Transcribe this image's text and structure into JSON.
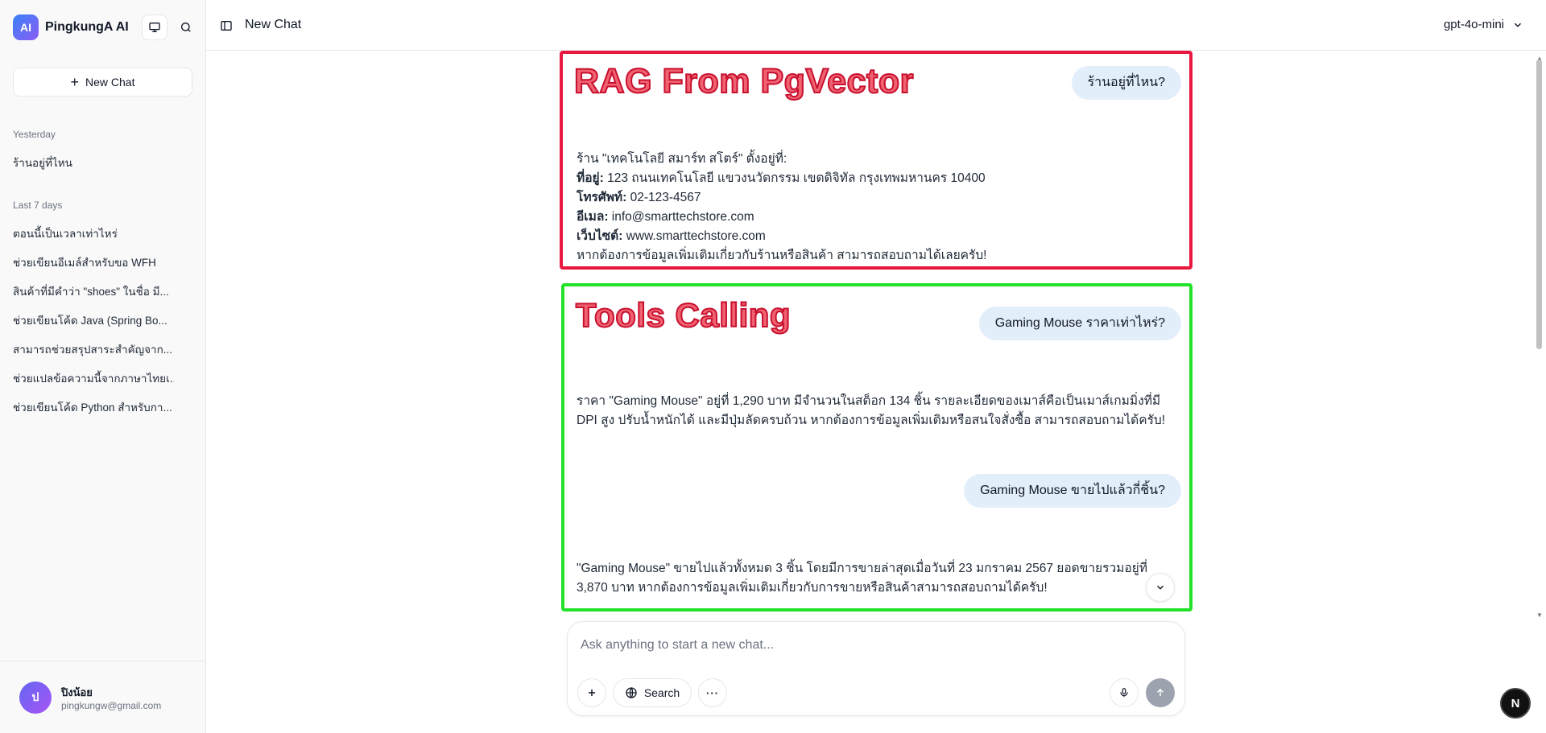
{
  "app": {
    "logo_text": "AI",
    "name": "PingkungA AI"
  },
  "sidebar": {
    "new_chat_label": "New Chat",
    "groups": [
      {
        "label": "Yesterday",
        "items": [
          "ร้านอยู่ที่ไหน"
        ]
      },
      {
        "label": "Last 7 days",
        "items": [
          "ตอนนี้เป็นเวลาเท่าไหร่",
          "ช่วยเขียนอีเมล์สำหรับขอ WFH",
          "สินค้าที่มีคำว่า \"shoes\" ในชื่อ มี...",
          "ช่วยเขียนโค้ด Java (Spring Bo...",
          "สามารถช่วยสรุปสาระสำคัญจาก...",
          "ช่วยแปลข้อความนี้จากภาษาไทยเ...",
          "ช่วยเขียนโค้ด Python สำหรับกา..."
        ]
      }
    ],
    "user": {
      "avatar_initial": "ป",
      "name": "ปิงน้อย",
      "email": "pingkungw@gmail.com"
    }
  },
  "header": {
    "title": "New Chat",
    "model": "gpt-4o-mini"
  },
  "overlays": {
    "rag_title": "RAG From PgVector",
    "tools_title": "Tools Calling",
    "rag_color": "#e8173e",
    "tools_color": "#22e22b"
  },
  "messages": {
    "rag_user": "ร้านอยู่ที่ไหน?",
    "rag_assistant": {
      "intro": "ร้าน \"เทคโนโลยี สมาร์ท สโตร์\" ตั้งอยู่ที่:",
      "address_label": "ที่อยู่:",
      "address_value": "123 ถนนเทคโนโลยี แขวงนวัตกรรม เขตดิจิทัล กรุงเทพมหานคร 10400",
      "phone_label": "โทรศัพท์:",
      "phone_value": "02-123-4567",
      "email_label": "อีเมล:",
      "email_value": "info@smarttechstore.com",
      "website_label": "เว็บไซต์:",
      "website_value": "www.smarttechstore.com",
      "closing": "หากต้องการข้อมูลเพิ่มเติมเกี่ยวกับร้านหรือสินค้า สามารถสอบถามได้เลยครับ!"
    },
    "tools_user_1": "Gaming Mouse ราคาเท่าไหร่?",
    "tools_assistant_1_line1": "ราคา \"Gaming Mouse\" อยู่ที่ 1,290 บาท มีจำนวนในสต็อก 134 ชิ้น รายละเอียดของเมาส์คือเป็นเมาส์เกมมิ่งที่มี",
    "tools_assistant_1_line2": "DPI สูง ปรับน้ำหนักได้ และมีปุ่มลัดครบถ้วน หากต้องการข้อมูลเพิ่มเติมหรือสนใจสั่งซื้อ สามารถสอบถามได้ครับ!",
    "tools_user_2": "Gaming Mouse ขายไปแล้วกี่ชิ้น?",
    "tools_assistant_2_line1": "\"Gaming Mouse\" ขายไปแล้วทั้งหมด 3 ชิ้น โดยมีการขายล่าสุดเมื่อวันที่ 23 มกราคม 2567 ยอดขายรวมอยู่ที่",
    "tools_assistant_2_line2": "3,870 บาท หากต้องการข้อมูลเพิ่มเติมเกี่ยวกับการขายหรือสินค้าสามารถสอบถามได้ครับ!"
  },
  "composer": {
    "placeholder": "Ask anything to start a new chat...",
    "search_label": "Search"
  },
  "badge": {
    "letter": "N"
  }
}
